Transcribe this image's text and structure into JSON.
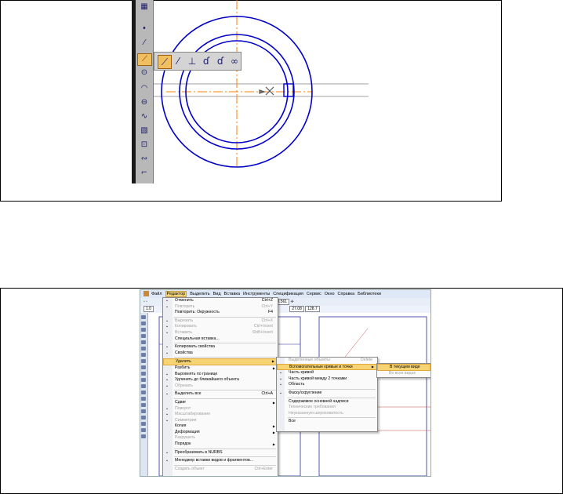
{
  "edit_menu": {
    "items": [
      {
        "icon": "undo-icon",
        "label": "Отменить",
        "shortcut": "Ctrl+Z",
        "disabled": false
      },
      {
        "icon": "redo-icon",
        "label": "Повторить",
        "shortcut": "Ctrl+Y",
        "disabled": true
      },
      {
        "icon": "",
        "label": "Повторить: Окружность",
        "shortcut": "F4",
        "disabled": false
      },
      {
        "separator": true
      },
      {
        "icon": "cut-icon",
        "label": "Вырезать",
        "shortcut": "Ctrl+X",
        "disabled": true
      },
      {
        "icon": "copy-icon",
        "label": "Копировать",
        "shortcut": "Ctrl+Insert",
        "disabled": true
      },
      {
        "icon": "paste-icon",
        "label": "Вставить",
        "shortcut": "Shift+Insert",
        "disabled": true
      },
      {
        "icon": "",
        "label": "Специальная вставка...",
        "shortcut": "",
        "disabled": false
      },
      {
        "separator": true
      },
      {
        "icon": "copy-properties-icon",
        "label": "Копировать свойства",
        "shortcut": "",
        "disabled": false
      },
      {
        "icon": "properties-icon",
        "label": "Свойства",
        "shortcut": "",
        "disabled": false
      },
      {
        "separator": true
      },
      {
        "icon": "",
        "label": "Удалить",
        "shortcut": "",
        "submenu": true,
        "highlighted": true,
        "disabled": false
      },
      {
        "icon": "",
        "label": "Разбить",
        "shortcut": "",
        "submenu": true,
        "disabled": false
      },
      {
        "icon": "align-icon",
        "label": "Выровнять по границе",
        "shortcut": "",
        "disabled": false
      },
      {
        "icon": "extend-icon",
        "label": "Удлинить до ближайшего объекта",
        "shortcut": "",
        "disabled": false
      },
      {
        "icon": "trim-icon",
        "label": "Обрезать",
        "shortcut": "",
        "disabled": true
      },
      {
        "separator": true
      },
      {
        "icon": "select-all-icon",
        "label": "Выделить все",
        "shortcut": "Ctrl+A",
        "disabled": false
      },
      {
        "separator": true
      },
      {
        "icon": "",
        "label": "Сдвиг",
        "shortcut": "",
        "submenu": true,
        "disabled": false
      },
      {
        "icon": "rotate-icon",
        "label": "Поворот",
        "shortcut": "",
        "disabled": true
      },
      {
        "icon": "scale-icon",
        "label": "Масштабирование",
        "shortcut": "",
        "disabled": true
      },
      {
        "icon": "mirror-icon",
        "label": "Симметрия",
        "shortcut": "",
        "disabled": true
      },
      {
        "icon": "",
        "label": "Копия",
        "shortcut": "",
        "submenu": true,
        "disabled": false
      },
      {
        "icon": "",
        "label": "Деформация",
        "shortcut": "",
        "submenu": true,
        "disabled": false
      },
      {
        "icon": "",
        "label": "Разрушить",
        "shortcut": "",
        "disabled": true
      },
      {
        "icon": "",
        "label": "Порядок",
        "shortcut": "",
        "submenu": true,
        "disabled": false
      },
      {
        "separator": true
      },
      {
        "icon": "nurbs-icon",
        "label": "Преобразовать в NURBS",
        "shortcut": "",
        "disabled": false
      },
      {
        "separator": true
      },
      {
        "icon": "manager-icon",
        "label": "Менеджер вставки видов и фрагментов...",
        "shortcut": "",
        "disabled": false
      },
      {
        "separator": true
      },
      {
        "icon": "",
        "label": "Создать объект",
        "shortcut": "Ctrl+Enter",
        "disabled": true
      }
    ]
  },
  "delete_submenu": {
    "items": [
      {
        "icon": "",
        "label": "Выделенные объекты",
        "shortcut": "Delete",
        "disabled": true
      },
      {
        "icon": "",
        "label": "Вспомогательные кривые и точки",
        "shortcut": "",
        "submenu": true,
        "highlighted": true,
        "disabled": false
      },
      {
        "icon": "curve-part-icon",
        "label": "Часть кривой",
        "shortcut": "",
        "disabled": false
      },
      {
        "icon": "curve-part-two-points-icon",
        "label": "Часть кривой между 2 точками",
        "shortcut": "",
        "disabled": false
      },
      {
        "icon": "area-icon",
        "label": "Область",
        "shortcut": "",
        "disabled": false
      },
      {
        "separator": true
      },
      {
        "icon": "fillet-icon",
        "label": "Фаску/скругление",
        "shortcut": "",
        "disabled": false
      },
      {
        "separator": true
      },
      {
        "icon": "",
        "label": "Содержимое основной надписи",
        "shortcut": "",
        "disabled": false
      },
      {
        "icon": "",
        "label": "Технические требования",
        "shortcut": "",
        "disabled": true
      },
      {
        "icon": "",
        "label": "Неуказанную шероховатость",
        "shortcut": "",
        "disabled": true
      },
      {
        "separator": true
      },
      {
        "icon": "",
        "label": "Все",
        "shortcut": "",
        "disabled": false
      }
    ]
  },
  "view_submenu": {
    "items": [
      {
        "label": "В текущем виде",
        "highlighted": true,
        "disabled": false
      },
      {
        "label": "Во всех видах",
        "disabled": true
      }
    ]
  },
  "menubar": {
    "items": [
      "Файл",
      "Редактор",
      "Выделить",
      "Вид",
      "Вставка",
      "Инструменты",
      "Спецификация",
      "Сервис",
      "Окно",
      "Справка",
      "Библиотеки"
    ],
    "active_index": 1
  },
  "toolbar": {
    "scale_value": "1.0",
    "zoom_value": "0.561",
    "coord_x": "27.08",
    "coord_y": "128.7"
  },
  "colors": {
    "curve_blue": "#0000c8",
    "axis_orange": "#ff7f00",
    "highlight": "#f6d373"
  }
}
